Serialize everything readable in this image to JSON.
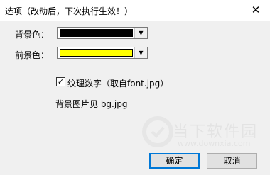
{
  "window": {
    "title": "选项（改动后，下次执行生效！）",
    "close_glyph": "✕"
  },
  "form": {
    "background_color_label": "背景色：",
    "background_color_value": "#000000",
    "foreground_color_label": "前景色：",
    "foreground_color_value": "#ffff00",
    "texture_checkbox_checked": true,
    "texture_checkbox_label": "纹理数字（取自font.jpg）",
    "background_image_label": "背景图片见 bg.jpg"
  },
  "buttons": {
    "ok_label": "确定",
    "cancel_label": "取消"
  },
  "watermark": {
    "text": "当下软件园",
    "url": "www.downxia.com"
  }
}
